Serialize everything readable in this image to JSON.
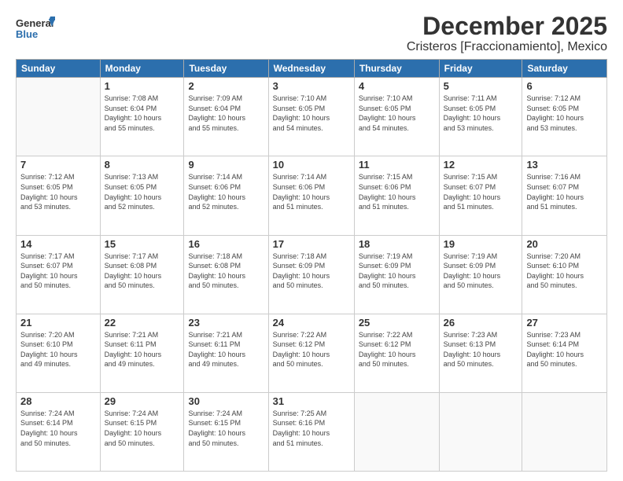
{
  "logo": {
    "general": "General",
    "blue": "Blue"
  },
  "title": "December 2025",
  "subtitle": "Cristeros [Fraccionamiento], Mexico",
  "weekdays": [
    "Sunday",
    "Monday",
    "Tuesday",
    "Wednesday",
    "Thursday",
    "Friday",
    "Saturday"
  ],
  "weeks": [
    [
      {
        "day": "",
        "info": ""
      },
      {
        "day": "1",
        "info": "Sunrise: 7:08 AM\nSunset: 6:04 PM\nDaylight: 10 hours\nand 55 minutes."
      },
      {
        "day": "2",
        "info": "Sunrise: 7:09 AM\nSunset: 6:04 PM\nDaylight: 10 hours\nand 55 minutes."
      },
      {
        "day": "3",
        "info": "Sunrise: 7:10 AM\nSunset: 6:05 PM\nDaylight: 10 hours\nand 54 minutes."
      },
      {
        "day": "4",
        "info": "Sunrise: 7:10 AM\nSunset: 6:05 PM\nDaylight: 10 hours\nand 54 minutes."
      },
      {
        "day": "5",
        "info": "Sunrise: 7:11 AM\nSunset: 6:05 PM\nDaylight: 10 hours\nand 53 minutes."
      },
      {
        "day": "6",
        "info": "Sunrise: 7:12 AM\nSunset: 6:05 PM\nDaylight: 10 hours\nand 53 minutes."
      }
    ],
    [
      {
        "day": "7",
        "info": "Sunrise: 7:12 AM\nSunset: 6:05 PM\nDaylight: 10 hours\nand 53 minutes."
      },
      {
        "day": "8",
        "info": "Sunrise: 7:13 AM\nSunset: 6:05 PM\nDaylight: 10 hours\nand 52 minutes."
      },
      {
        "day": "9",
        "info": "Sunrise: 7:14 AM\nSunset: 6:06 PM\nDaylight: 10 hours\nand 52 minutes."
      },
      {
        "day": "10",
        "info": "Sunrise: 7:14 AM\nSunset: 6:06 PM\nDaylight: 10 hours\nand 51 minutes."
      },
      {
        "day": "11",
        "info": "Sunrise: 7:15 AM\nSunset: 6:06 PM\nDaylight: 10 hours\nand 51 minutes."
      },
      {
        "day": "12",
        "info": "Sunrise: 7:15 AM\nSunset: 6:07 PM\nDaylight: 10 hours\nand 51 minutes."
      },
      {
        "day": "13",
        "info": "Sunrise: 7:16 AM\nSunset: 6:07 PM\nDaylight: 10 hours\nand 51 minutes."
      }
    ],
    [
      {
        "day": "14",
        "info": "Sunrise: 7:17 AM\nSunset: 6:07 PM\nDaylight: 10 hours\nand 50 minutes."
      },
      {
        "day": "15",
        "info": "Sunrise: 7:17 AM\nSunset: 6:08 PM\nDaylight: 10 hours\nand 50 minutes."
      },
      {
        "day": "16",
        "info": "Sunrise: 7:18 AM\nSunset: 6:08 PM\nDaylight: 10 hours\nand 50 minutes."
      },
      {
        "day": "17",
        "info": "Sunrise: 7:18 AM\nSunset: 6:09 PM\nDaylight: 10 hours\nand 50 minutes."
      },
      {
        "day": "18",
        "info": "Sunrise: 7:19 AM\nSunset: 6:09 PM\nDaylight: 10 hours\nand 50 minutes."
      },
      {
        "day": "19",
        "info": "Sunrise: 7:19 AM\nSunset: 6:09 PM\nDaylight: 10 hours\nand 50 minutes."
      },
      {
        "day": "20",
        "info": "Sunrise: 7:20 AM\nSunset: 6:10 PM\nDaylight: 10 hours\nand 50 minutes."
      }
    ],
    [
      {
        "day": "21",
        "info": "Sunrise: 7:20 AM\nSunset: 6:10 PM\nDaylight: 10 hours\nand 49 minutes."
      },
      {
        "day": "22",
        "info": "Sunrise: 7:21 AM\nSunset: 6:11 PM\nDaylight: 10 hours\nand 49 minutes."
      },
      {
        "day": "23",
        "info": "Sunrise: 7:21 AM\nSunset: 6:11 PM\nDaylight: 10 hours\nand 49 minutes."
      },
      {
        "day": "24",
        "info": "Sunrise: 7:22 AM\nSunset: 6:12 PM\nDaylight: 10 hours\nand 50 minutes."
      },
      {
        "day": "25",
        "info": "Sunrise: 7:22 AM\nSunset: 6:12 PM\nDaylight: 10 hours\nand 50 minutes."
      },
      {
        "day": "26",
        "info": "Sunrise: 7:23 AM\nSunset: 6:13 PM\nDaylight: 10 hours\nand 50 minutes."
      },
      {
        "day": "27",
        "info": "Sunrise: 7:23 AM\nSunset: 6:14 PM\nDaylight: 10 hours\nand 50 minutes."
      }
    ],
    [
      {
        "day": "28",
        "info": "Sunrise: 7:24 AM\nSunset: 6:14 PM\nDaylight: 10 hours\nand 50 minutes."
      },
      {
        "day": "29",
        "info": "Sunrise: 7:24 AM\nSunset: 6:15 PM\nDaylight: 10 hours\nand 50 minutes."
      },
      {
        "day": "30",
        "info": "Sunrise: 7:24 AM\nSunset: 6:15 PM\nDaylight: 10 hours\nand 50 minutes."
      },
      {
        "day": "31",
        "info": "Sunrise: 7:25 AM\nSunset: 6:16 PM\nDaylight: 10 hours\nand 51 minutes."
      },
      {
        "day": "",
        "info": ""
      },
      {
        "day": "",
        "info": ""
      },
      {
        "day": "",
        "info": ""
      }
    ]
  ]
}
